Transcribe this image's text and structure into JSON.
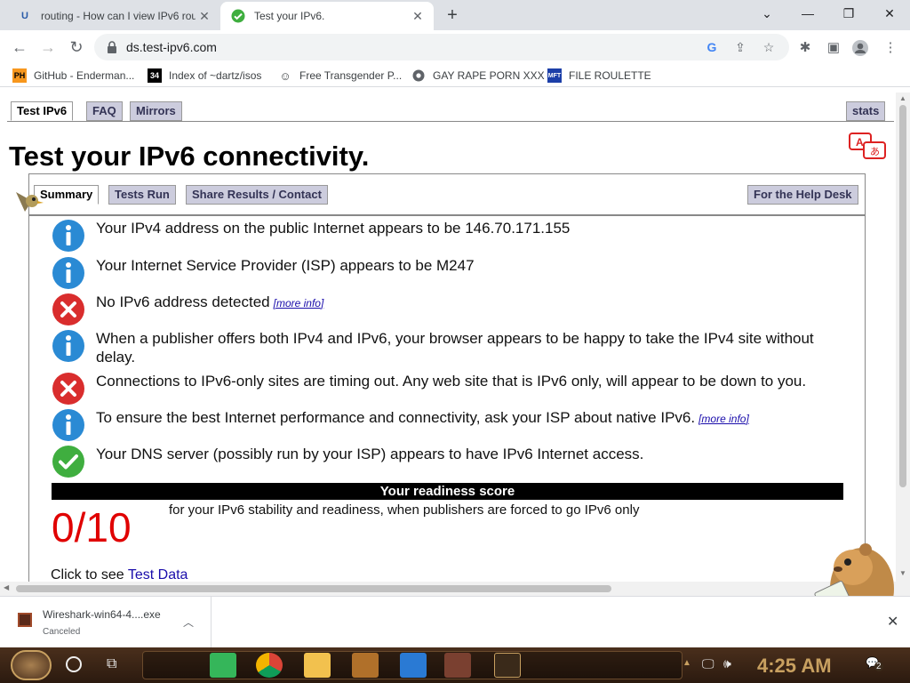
{
  "browser": {
    "tabs": [
      {
        "title": "routing - How can I view IPv6 rou",
        "favicon": "U"
      },
      {
        "title": "Test your IPv6.",
        "favicon": "check-icon"
      }
    ],
    "new_tab": "+",
    "url": "ds.test-ipv6.com",
    "bookmarks": [
      {
        "label": "GitHub - Enderman...",
        "icon": "PH"
      },
      {
        "label": "Index of ~dartz/isos",
        "icon": "34"
      },
      {
        "label": "Free Transgender P...",
        "icon": "mask-icon"
      },
      {
        "label": "GAY RAPE PORN XXX",
        "icon": "globe-icon"
      },
      {
        "label": "FILE ROULETTE",
        "icon": "MFT"
      }
    ]
  },
  "site": {
    "tabs": [
      "Test IPv6",
      "FAQ",
      "Mirrors"
    ],
    "stats": "stats",
    "title": "Test your IPv6 connectivity.",
    "subtabs": [
      "Summary",
      "Tests Run",
      "Share Results / Contact"
    ],
    "helpdesk": "For the Help Desk",
    "results": [
      {
        "type": "info",
        "text": "Your IPv4 address on the public Internet appears to be 146.70.171.155",
        "more": ""
      },
      {
        "type": "info",
        "text": "Your Internet Service Provider (ISP) appears to be M247",
        "more": ""
      },
      {
        "type": "error",
        "text": "No IPv6 address detected",
        "more": "[more info]"
      },
      {
        "type": "info",
        "text": "When a publisher offers both IPv4 and IPv6, your browser appears to be happy to take the IPv4 site without delay.",
        "more": ""
      },
      {
        "type": "error",
        "text": "Connections to IPv6-only sites are timing out. Any web site that is IPv6 only, will appear to be down to you.",
        "more": ""
      },
      {
        "type": "info",
        "text": "To ensure the best Internet performance and connectivity, ask your ISP about native IPv6.",
        "more": "[more info]"
      },
      {
        "type": "ok",
        "text": "Your DNS server (possibly run by your ISP) appears to have IPv6 Internet access.",
        "more": ""
      }
    ],
    "readiness_label": "Your readiness score",
    "score": "0/10",
    "score_note": "for your IPv6 stability and readiness, when publishers are forced to go IPv6 only",
    "test_data_prefix": "Click to see ",
    "test_data_link": "Test Data"
  },
  "download": {
    "filename": "Wireshark-win64-4....exe",
    "status": "Canceled"
  },
  "taskbar": {
    "time": "4:25 AM",
    "notification_count": "2"
  },
  "colors": {
    "info": "#2a8ad4",
    "error": "#d92d2d",
    "ok": "#3fae3f",
    "score": "#e00000"
  }
}
